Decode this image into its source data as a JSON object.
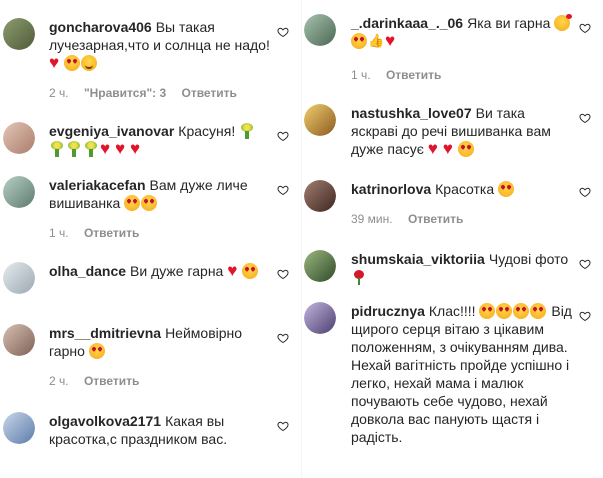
{
  "left_comments": [
    {
      "username": "goncharova406",
      "text": "Вы такая лучезарная,что и солнца не надо!",
      "emojis": [
        "heart",
        "grin",
        "smile"
      ],
      "time": "2 ч.",
      "likes": "\"Нравится\": 3",
      "reply": "Ответить",
      "avatar_color": "#6b7d52"
    },
    {
      "username": "evgeniya_ivanovar",
      "text": "Красуня!",
      "emojis": [
        "bouquet",
        "bouquet",
        "bouquet",
        "bouquet",
        "heart",
        "heart",
        "heart"
      ],
      "time": "",
      "likes": "",
      "reply": "",
      "avatar_color": "#c9a28f"
    },
    {
      "username": "valeriakacefan",
      "text": "Вам дуже личе вишиванка",
      "emojis": [
        "grin",
        "grin"
      ],
      "time": "1 ч.",
      "likes": "",
      "reply": "Ответить",
      "avatar_color": "#8fa7a0"
    },
    {
      "username": "olha_dance",
      "text": "Ви дуже гарна",
      "emojis": [
        "heart",
        "grin"
      ],
      "time": "",
      "likes": "",
      "reply": "",
      "avatar_color": "#c7cfd4"
    },
    {
      "username": "mrs__dmitrievna",
      "text": "Неймовірно гарно",
      "emojis": [
        "grin"
      ],
      "time": "2 ч.",
      "likes": "",
      "reply": "Ответить",
      "avatar_color": "#b79a8c"
    },
    {
      "username": "olgavolkova2171",
      "text": "Какая вы красотка,с праздником вас.",
      "emojis": [],
      "time": "",
      "likes": "",
      "reply": "",
      "avatar_color": "#8aa1c2"
    }
  ],
  "right_comments": [
    {
      "username": "_.darinkaaa_._06",
      "text": "Яка ви гарна",
      "emojis": [
        "kiss",
        "grin",
        "thumb",
        "heart"
      ],
      "time": "1 ч.",
      "likes": "",
      "reply": "Ответить",
      "avatar_color": "#7e9a86"
    },
    {
      "username": "nastushka_love07",
      "text": "Ви така яскраві до речі вишиванка вам дуже пасує",
      "emojis": [
        "heart",
        "heart",
        "grin"
      ],
      "time": "",
      "likes": "",
      "reply": "",
      "avatar_color": "#c7a03b"
    },
    {
      "username": "katrinorlova",
      "text": "Красотка",
      "emojis": [
        "grin"
      ],
      "time": "39 мин.",
      "likes": "",
      "reply": "Ответить",
      "avatar_color": "#6b4a3f"
    },
    {
      "username": "shumskaia_viktoriia",
      "text": "Чудові фото",
      "emojis": [
        "rose"
      ],
      "time": "",
      "likes": "",
      "reply": "",
      "avatar_color": "#5e7a4e"
    },
    {
      "username": "pidrucznya",
      "text": "Клас!!!!",
      "text2": "Від щирого серця вітаю з цікавим положенням, з очікуванням дива. Нехай вагітність пройде успішно і легко, нехай мама і малюк почувають себе чудово, нехай довкола вас панують щастя і радість.",
      "emojis": [
        "grin",
        "grin",
        "grin",
        "grin"
      ],
      "time": "",
      "likes": "",
      "reply": "",
      "avatar_color": "#8a7db0"
    }
  ],
  "icons": {
    "like": "heart-outline-icon"
  }
}
